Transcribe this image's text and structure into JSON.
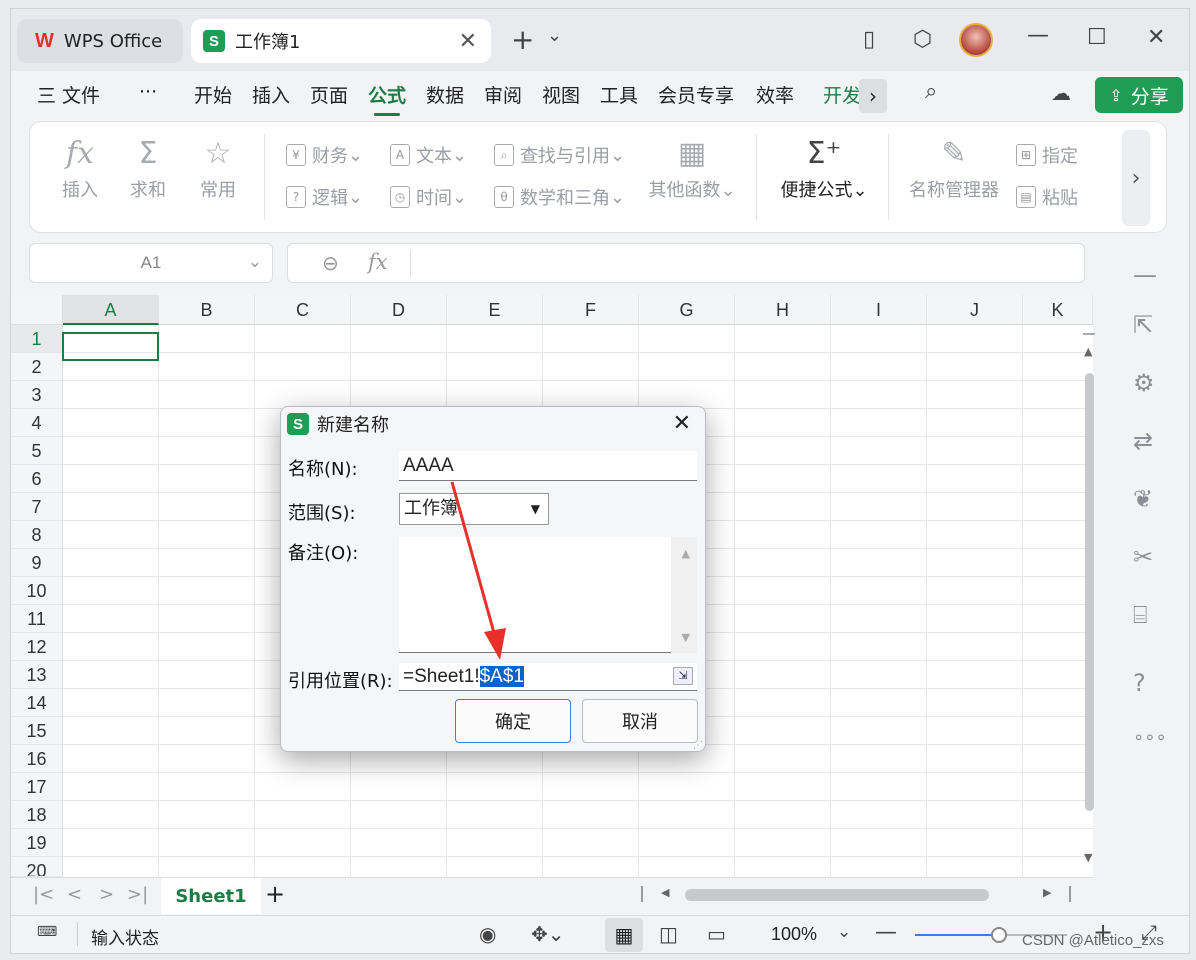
{
  "tabs": {
    "wps_label": "WPS Office",
    "book_label": "工作簿1",
    "new_tab": "+",
    "tab_menu": "⌄"
  },
  "menubar": {
    "more": "···",
    "items": [
      "三 文件",
      "开始",
      "插入",
      "页面",
      "公式",
      "数据",
      "审阅",
      "视图",
      "工具",
      "会员专享",
      "效率",
      "开发"
    ],
    "active": "公式",
    "share_label": "分享"
  },
  "ribbon": {
    "insert_fn": "插入",
    "sum": "求和",
    "common": "常用",
    "finance": "财务",
    "text": "文本",
    "lookup": "查找与引用",
    "logic": "逻辑",
    "time": "时间",
    "math": "数学和三角",
    "other": "其他函数",
    "quick_formula": "便捷公式",
    "name_manager": "名称管理器",
    "specify": "指定",
    "paste": "粘贴"
  },
  "formula_bar": {
    "cell_ref": "A1",
    "fx": "fx",
    "content": ""
  },
  "grid": {
    "columns": [
      "A",
      "B",
      "C",
      "D",
      "E",
      "F",
      "G",
      "H",
      "I",
      "J",
      "K"
    ],
    "rows": [
      "1",
      "2",
      "3",
      "4",
      "5",
      "6",
      "7",
      "8",
      "9",
      "10",
      "11",
      "12",
      "13",
      "14",
      "15",
      "16",
      "17",
      "18",
      "19",
      "20"
    ],
    "active_cell": "A1"
  },
  "sheets": {
    "active": "Sheet1",
    "add": "+"
  },
  "status": {
    "input_state": "输入状态",
    "zoom": "100%",
    "zoom_level": 0.55
  },
  "dialog": {
    "title": "新建名称",
    "name_label": "名称(N):",
    "name_value": "AAAA",
    "scope_label": "范围(S):",
    "scope_value": "工作簿",
    "comment_label": "备注(O):",
    "comment_value": "",
    "ref_label": "引用位置(R):",
    "ref_prefix": "=Sheet1!",
    "ref_selected": "$A$1",
    "ok_label": "确定",
    "cancel_label": "取消"
  },
  "watermark": "CSDN @Atletico_zxs",
  "colors": {
    "accent": "#1b7d43",
    "share": "#1f9d55",
    "arrow": "#e8302a",
    "selection": "#0a64c8"
  }
}
